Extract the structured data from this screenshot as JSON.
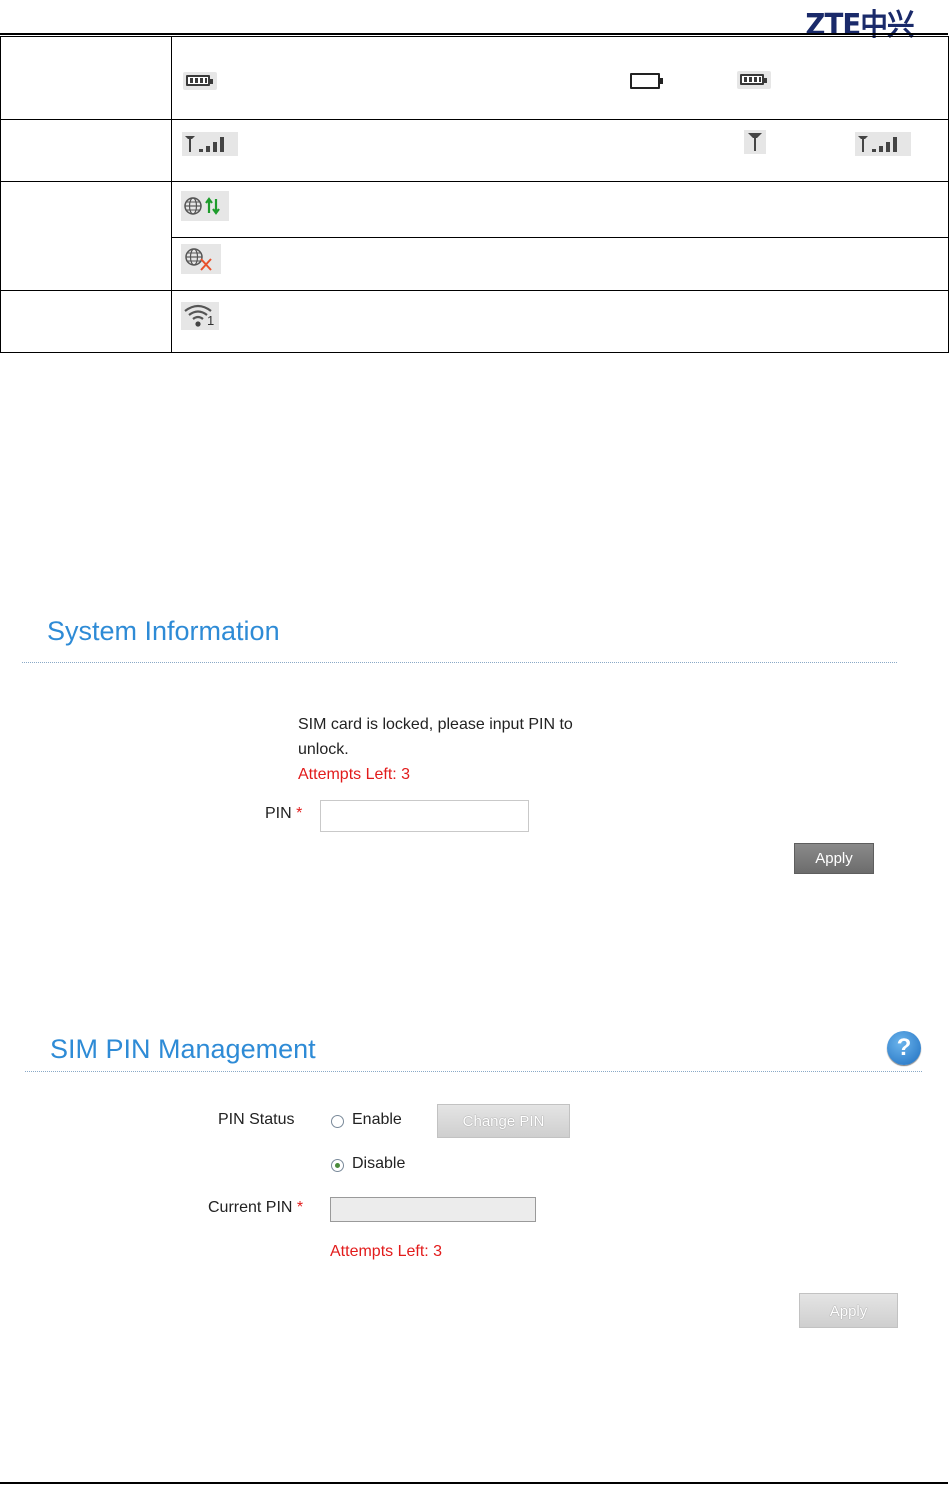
{
  "header": {
    "logo_text": "ZTE中兴"
  },
  "icon_table": {
    "rows": [
      {
        "label": "",
        "icons": [
          "battery-full-icon",
          "battery-empty-icon",
          "battery-full-icon"
        ]
      },
      {
        "label": "",
        "icons": [
          "signal-strength-icon",
          "signal-none-icon",
          "signal-strength-icon"
        ]
      },
      {
        "label": "",
        "icons": [
          "internet-connected-icon"
        ]
      },
      {
        "label": "",
        "icons": [
          "internet-disconnected-icon"
        ]
      },
      {
        "label": "",
        "icons": [
          "wifi-clients-icon"
        ],
        "wifi_count": "1"
      }
    ]
  },
  "system_info": {
    "title": "System Information",
    "message": "SIM card is locked, please input PIN to unlock.",
    "message_line1": "SIM card is locked, please input PIN to",
    "message_line2": "unlock.",
    "attempts": "Attempts Left: 3",
    "pin_label": "PIN",
    "required_mark": "*",
    "pin_value": "",
    "apply_label": "Apply"
  },
  "sim_pin": {
    "title": "SIM PIN Management",
    "help_symbol": "?",
    "pin_status_label": "PIN Status",
    "enable_label": "Enable",
    "disable_label": "Disable",
    "selected": "Disable",
    "change_pin_label": "Change PIN",
    "current_pin_label": "Current PIN",
    "required_mark": "*",
    "current_pin_value": "",
    "attempts": "Attempts Left: 3",
    "apply_label": "Apply"
  },
  "colors": {
    "title_blue": "#2e8bd6",
    "attempts_red": "#e21b1b",
    "button_dark": "#6c6c6c",
    "help_blue": "#1f6fc0"
  }
}
